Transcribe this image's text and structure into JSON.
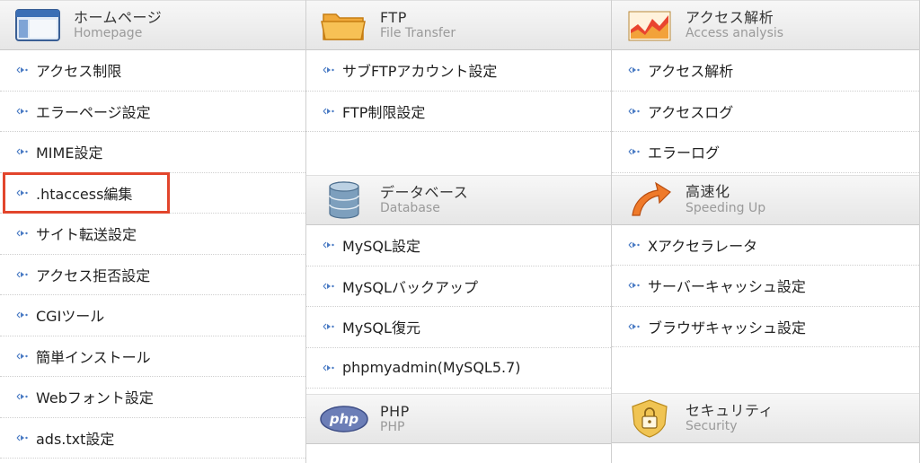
{
  "homepage": {
    "title_jp": "ホームページ",
    "title_en": "Homepage",
    "icon": "window-icon",
    "items": [
      {
        "label": "アクセス制限"
      },
      {
        "label": "エラーページ設定"
      },
      {
        "label": "MIME設定"
      },
      {
        "label": ".htaccess編集"
      },
      {
        "label": "サイト転送設定"
      },
      {
        "label": "アクセス拒否設定"
      },
      {
        "label": "CGIツール"
      },
      {
        "label": "簡単インストール"
      },
      {
        "label": "Webフォント設定"
      },
      {
        "label": "ads.txt設定"
      }
    ]
  },
  "ftp": {
    "title_jp": "FTP",
    "title_en": "File Transfer",
    "icon": "folder-icon",
    "items": [
      {
        "label": "サブFTPアカウント設定"
      },
      {
        "label": "FTP制限設定"
      }
    ]
  },
  "database": {
    "title_jp": "データベース",
    "title_en": "Database",
    "icon": "database-icon",
    "items": [
      {
        "label": "MySQL設定"
      },
      {
        "label": "MySQLバックアップ"
      },
      {
        "label": "MySQL復元"
      },
      {
        "label": "phpmyadmin(MySQL5.7)"
      }
    ]
  },
  "php": {
    "title_jp": "PHP",
    "title_en": "PHP",
    "icon": "php-icon",
    "icon_text": "php"
  },
  "access_analysis": {
    "title_jp": "アクセス解析",
    "title_en": "Access analysis",
    "icon": "chart-icon",
    "items": [
      {
        "label": "アクセス解析"
      },
      {
        "label": "アクセスログ"
      },
      {
        "label": "エラーログ"
      }
    ]
  },
  "speeding_up": {
    "title_jp": "高速化",
    "title_en": "Speeding Up",
    "icon": "speed-arrow-icon",
    "items": [
      {
        "label": "Xアクセラレータ"
      },
      {
        "label": "サーバーキャッシュ設定"
      },
      {
        "label": "ブラウザキャッシュ設定"
      }
    ]
  },
  "security": {
    "title_jp": "セキュリティ",
    "title_en": "Security",
    "icon": "lock-icon"
  },
  "colors": {
    "highlight": "#e2452c",
    "arrow": "#4a7bc4",
    "border": "#cfcfcf"
  }
}
